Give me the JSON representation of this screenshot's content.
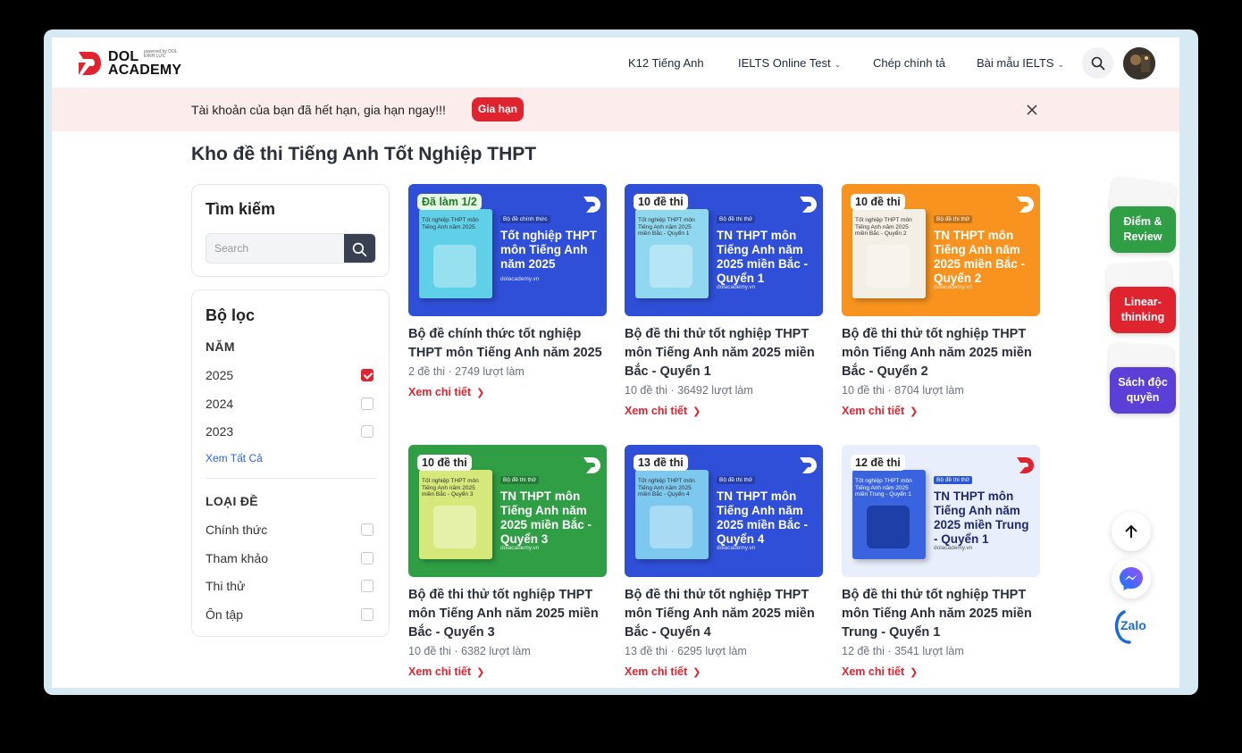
{
  "header": {
    "logo_main": "DOL\nACADEMY",
    "logo_sub": "powered by DOL ĐÌNH LỰC",
    "nav": [
      {
        "label": "K12 Tiếng Anh",
        "dropdown": false
      },
      {
        "label": "IELTS Online Test",
        "dropdown": true
      },
      {
        "label": "Chép chính tả",
        "dropdown": false
      },
      {
        "label": "Bài mẫu IELTS",
        "dropdown": true
      }
    ]
  },
  "banner": {
    "text": "Tài khoản của bạn đã hết hạn, gia hạn ngay!!!",
    "button": "Gia hạn"
  },
  "page_title": "Kho đề thi Tiếng Anh Tốt Nghiệp THPT",
  "search": {
    "title": "Tìm kiếm",
    "placeholder": "Search"
  },
  "filter": {
    "title": "Bộ lọc",
    "year_group": "NĂM",
    "years": [
      {
        "label": "2025",
        "checked": true
      },
      {
        "label": "2024",
        "checked": false
      },
      {
        "label": "2023",
        "checked": false
      }
    ],
    "see_all": "Xem Tất Cả",
    "type_group": "LOẠI ĐỀ",
    "types": [
      {
        "label": "Chính thức",
        "checked": false
      },
      {
        "label": "Tham khảo",
        "checked": false
      },
      {
        "label": "Thi thử",
        "checked": false
      },
      {
        "label": "Ôn tập",
        "checked": false
      }
    ]
  },
  "cards": [
    {
      "badge": "Đã làm 1/2",
      "tag": "Bộ đề chính thức",
      "thumb_title": "Tốt nghiệp THPT môn Tiếng Anh năm 2025",
      "book_title": "Tốt nghiệp THPT môn Tiếng Anh năm 2025",
      "url": "dolacademy.vn",
      "title": "Bộ đề chính thức tốt nghiệp THPT môn Tiếng Anh năm 2025",
      "meta": "2 đề thi · 2749 lượt làm",
      "link": "Xem chi tiết",
      "bg": "#2f4fd8",
      "book_bg": "#5fd0e8"
    },
    {
      "badge": "10 đề thi",
      "tag": "Bộ đề thi thử",
      "thumb_title": "TN THPT môn Tiếng Anh năm 2025 miền Bắc - Quyển 1",
      "book_title": "Tốt nghiệp THPT môn Tiếng Anh năm 2025 miền Bắc - Quyển 1",
      "url": "dolacademy.vn",
      "title": "Bộ đề thi thử tốt nghiệp THPT môn Tiếng Anh năm 2025 miền Bắc - Quyển 1",
      "meta": "10 đề thi · 36492 lượt làm",
      "link": "Xem chi tiết",
      "bg": "#2f4fd8",
      "book_bg": "#8fd8f0"
    },
    {
      "badge": "10 đề thi",
      "tag": "Bộ đề thi thử",
      "thumb_title": "TN THPT môn Tiếng Anh năm 2025 miền Bắc - Quyển 2",
      "book_title": "Tốt nghiệp THPT môn Tiếng Anh năm 2025 miền Bắc - Quyển 2",
      "url": "dolacademy.vn",
      "title": "Bộ đề thi thử tốt nghiệp THPT môn Tiếng Anh năm 2025 miền Bắc - Quyển 2",
      "meta": "10 đề thi · 8704 lượt làm",
      "link": "Xem chi tiết",
      "bg": "#f7931e",
      "book_bg": "#f4efe4"
    },
    {
      "badge": "10 đề thi",
      "tag": "Bộ đề thi thử",
      "thumb_title": "TN THPT môn Tiếng Anh năm 2025 miền Bắc - Quyển 3",
      "book_title": "Tốt nghiệp THPT môn Tiếng Anh năm 2025 miền Bắc - Quyển 3",
      "url": "dolacademy.vn",
      "title": "Bộ đề thi thử tốt nghiệp THPT môn Tiếng Anh năm 2025 miền Bắc - Quyển 3",
      "meta": "10 đề thi · 6382 lượt làm",
      "link": "Xem chi tiết",
      "bg": "#2f9e44",
      "book_bg": "#d7e87a"
    },
    {
      "badge": "13 đề thi",
      "tag": "Bộ đề thi thử",
      "thumb_title": "TN THPT môn Tiếng Anh năm 2025 miền Bắc - Quyển 4",
      "book_title": "Tốt nghiệp THPT môn Tiếng Anh năm 2025 miền Bắc - Quyển 4",
      "url": "dolacademy.vn",
      "title": "Bộ đề thi thử tốt nghiệp THPT môn Tiếng Anh năm 2025 miền Bắc - Quyển 4",
      "meta": "13 đề thi · 6295 lượt làm",
      "link": "Xem chi tiết",
      "bg": "#2f4fd8",
      "book_bg": "#7cc8ee"
    },
    {
      "badge": "12 đề thi",
      "tag": "Bộ đề thi thử",
      "thumb_title": "TN THPT môn Tiếng Anh năm 2025 miền Trung - Quyển 1",
      "book_title": "Tốt nghiệp THPT môn Tiếng Anh năm 2025 miền Trung - Quyển 1",
      "url": "dolacademy.vn",
      "title": "Bộ đề thi thử tốt nghiệp THPT môn Tiếng Anh năm 2025 miền Trung - Quyển 1",
      "meta": "12 đề thi · 3541 lượt làm",
      "link": "Xem chi tiết",
      "bg": "#e8eefb",
      "book_bg": "#3a63e0"
    }
  ],
  "rail": {
    "items": [
      {
        "label": "Điểm & Review",
        "color": "#2f9e44"
      },
      {
        "label": "Linear-thinking",
        "color": "#e0242f"
      },
      {
        "label": "Sách độc quyền",
        "color": "#5b3fd6"
      }
    ],
    "zalo": "Zalo"
  },
  "colors": {
    "accent": "#e0242f",
    "link": "#2563eb"
  }
}
